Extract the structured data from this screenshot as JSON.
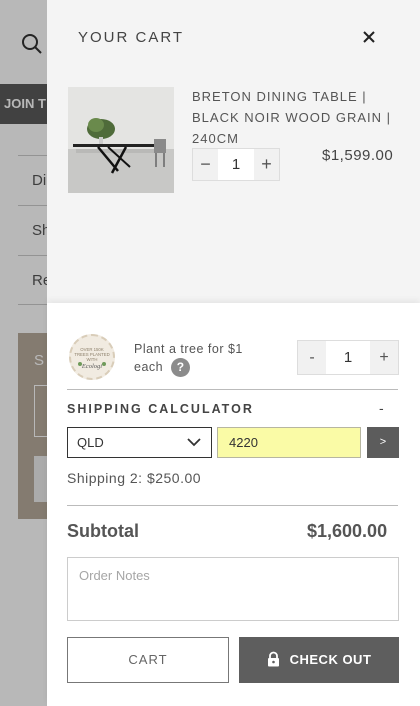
{
  "background": {
    "join_label": "JOIN T",
    "menu_items": [
      "Di",
      "Sh",
      "Re"
    ],
    "section_label": "S"
  },
  "cart": {
    "title": "YOUR CART",
    "close_icon": "close-icon",
    "item": {
      "name": "BRETON DINING TABLE | BLACK NOIR WOOD GRAIN | 240CM",
      "quantity": "1",
      "decrement_label": "−",
      "increment_label": "+",
      "price": "$1,599.00"
    },
    "tree": {
      "badge_text": "OVER 150K TREES PLANTED WITH Ecologi",
      "label": "Plant a tree for $1 each",
      "help_label": "?",
      "quantity": "1",
      "decrement_label": "-",
      "increment_label": "+"
    },
    "shipping": {
      "title": "SHIPPING CALCULATOR",
      "collapse_label": "-",
      "state_value": "QLD",
      "postcode_value": "4220",
      "go_label": ">",
      "result": "Shipping 2: $250.00"
    },
    "subtotal_label": "Subtotal",
    "subtotal_value": "$1,600.00",
    "notes_placeholder": "Order Notes",
    "cart_button_label": "CART",
    "checkout_button_label": "CHECK OUT",
    "colors": {
      "drawer_top": "#f4f4f4",
      "checkout": "#5e5e5e",
      "postcode_bg": "#fafba6"
    }
  }
}
